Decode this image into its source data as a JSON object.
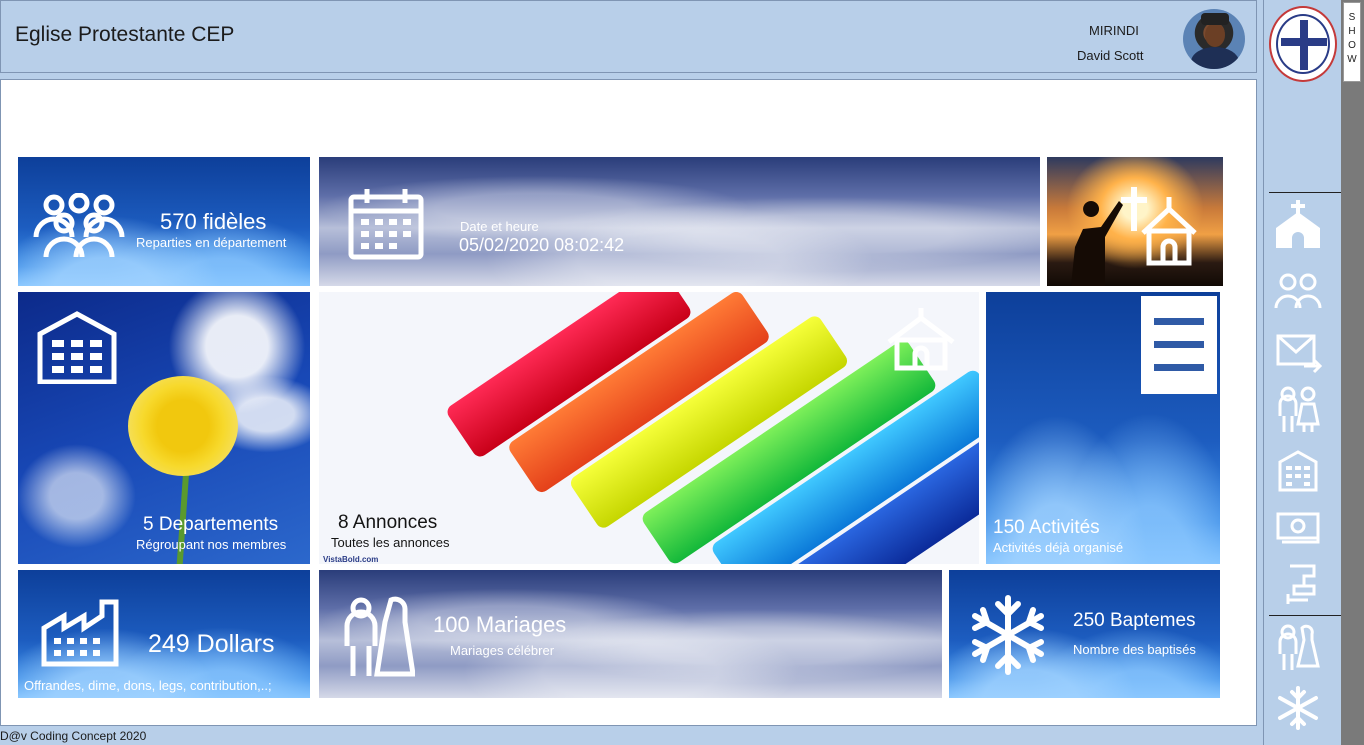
{
  "header": {
    "title": "Eglise Protestante CEP",
    "user_role": "MIRINDI",
    "user_name": "David Scott"
  },
  "rail": {
    "show_label": "SHOW",
    "items": [
      {
        "icon": "church-icon"
      },
      {
        "icon": "members-icon"
      },
      {
        "icon": "mail-send-icon"
      },
      {
        "icon": "couple-icon"
      },
      {
        "icon": "building-icon"
      },
      {
        "icon": "money-icon"
      },
      {
        "icon": "baptism-icon"
      },
      {
        "icon": "couple-icon"
      },
      {
        "icon": "snowflake-icon"
      }
    ]
  },
  "tiles": {
    "fideles": {
      "title": "570 fidèles",
      "subtitle": "Reparties en département"
    },
    "datetime": {
      "label": "Date et heure",
      "value": "05/02/2020 08:02:42"
    },
    "departements": {
      "title": "5 Departements",
      "subtitle": "Régroupant nos membres"
    },
    "annonces": {
      "title": "8 Annonces",
      "subtitle": "Toutes les annonces",
      "watermark": "VistaBold.com"
    },
    "activites": {
      "title": "150 Activités",
      "subtitle": "Activités déjà organisé"
    },
    "dollars": {
      "title": "249 Dollars",
      "subtitle": "Offrandes, dime, dons, legs, contribution,..;"
    },
    "mariages": {
      "title": "100 Mariages",
      "subtitle": "Mariages célébrer"
    },
    "baptemes": {
      "title": "250 Baptemes",
      "subtitle": "Nombre des baptisés"
    }
  },
  "footer": {
    "text": "D@v Coding Concept 2020"
  },
  "colors": {
    "frame": "#b8cfe9",
    "tile_blue": "#1d5dc0",
    "menu_bar": "#2f5aa6"
  }
}
